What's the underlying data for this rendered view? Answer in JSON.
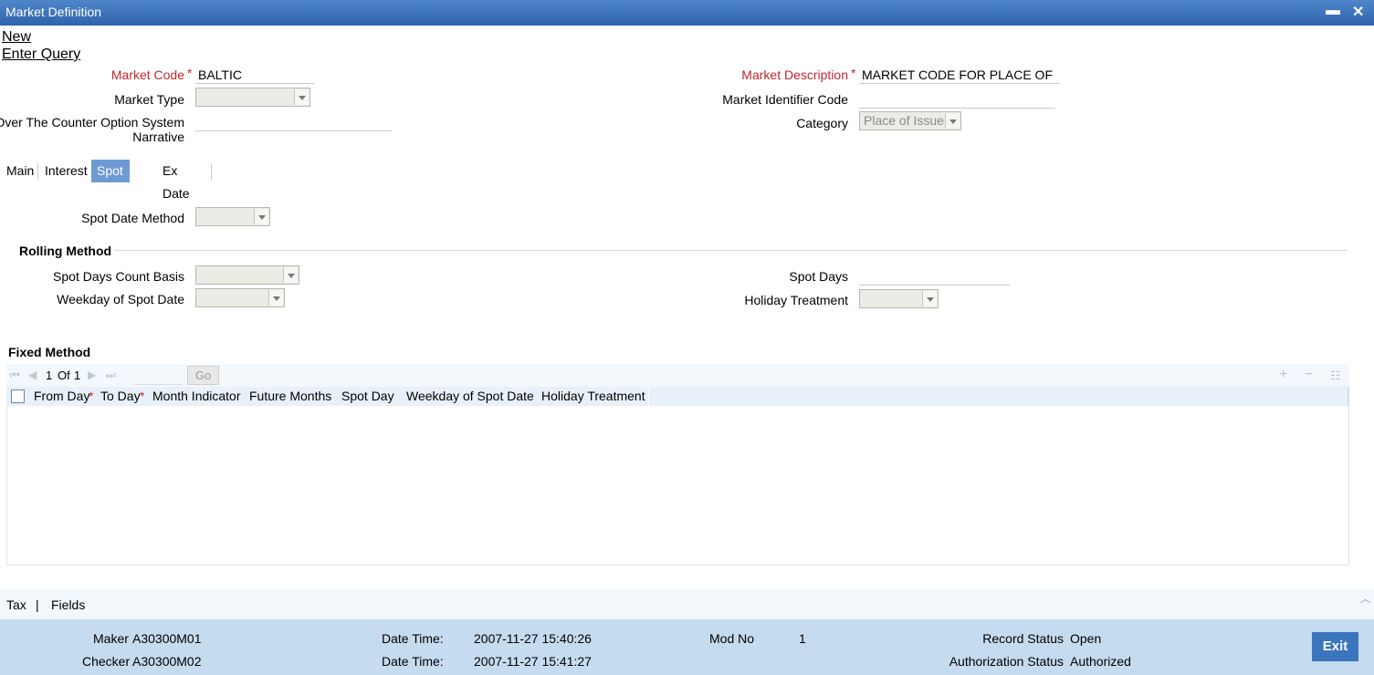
{
  "window": {
    "title": "Market Definition",
    "minimize": "▬",
    "close": "✕"
  },
  "menu": {
    "new": "New",
    "enter_query": "Enter Query"
  },
  "form": {
    "market_code_label": "Market Code",
    "market_code_value": "BALTIC",
    "market_type_label": "Market Type",
    "otc_label_line1": "Over The Counter Option System",
    "otc_label_line2": "Narrative",
    "market_description_label": "Market Description",
    "market_description_value": "MARKET CODE FOR PLACE OF ISSUE",
    "mic_label": "Market Identifier Code",
    "category_label": "Category",
    "category_value": "Place of Issue",
    "required_mark": "*"
  },
  "tabs": [
    {
      "label": "Main",
      "active": false
    },
    {
      "label": "Interest",
      "active": false
    },
    {
      "label": "Spot Date",
      "active": true
    },
    {
      "label": "Ex Date",
      "active": false
    }
  ],
  "spot": {
    "spot_date_method_label": "Spot Date Method",
    "rolling_method_title": "Rolling Method",
    "spot_days_count_basis_label": "Spot Days Count Basis",
    "weekday_of_spot_date_label": "Weekday of Spot Date",
    "spot_days_label": "Spot Days",
    "holiday_treatment_label": "Holiday Treatment",
    "fixed_method_title": "Fixed Method"
  },
  "grid": {
    "page_current": "1",
    "page_of": "Of",
    "page_total": "1",
    "go_label": "Go",
    "columns": [
      {
        "label": "From Day",
        "required": true
      },
      {
        "label": "To Day",
        "required": true
      },
      {
        "label": "Month Indicator",
        "required": false
      },
      {
        "label": "Future Months",
        "required": false
      },
      {
        "label": "Spot Day",
        "required": false
      },
      {
        "label": "Weekday of Spot Date",
        "required": false
      },
      {
        "label": "Holiday Treatment",
        "required": false
      }
    ]
  },
  "bottom_links": {
    "tax": "Tax",
    "sep": "|",
    "fields": "Fields"
  },
  "footer": {
    "maker_label": "Maker",
    "maker_value": "A30300M01",
    "checker_label": "Checker",
    "checker_value": "A30300M02",
    "datetime_label": "Date Time:",
    "maker_datetime": "2007-11-27 15:40:26",
    "checker_datetime": "2007-11-27 15:41:27",
    "mod_no_label": "Mod No",
    "mod_no_value": "1",
    "record_status_label": "Record Status",
    "record_status_value": "Open",
    "auth_status_label": "Authorization Status",
    "auth_status_value": "Authorized",
    "exit_label": "Exit"
  },
  "colors": {
    "titlebar": "#2f63ad",
    "active_tab": "#6e9ad3",
    "footer": "#c5dbf0",
    "exit_button": "#3b75bd",
    "required": "#c0262e"
  }
}
